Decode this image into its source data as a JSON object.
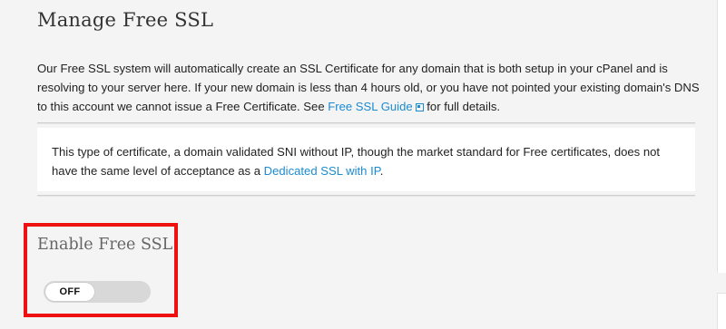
{
  "page": {
    "title": "Manage Free SSL"
  },
  "intro": {
    "text_before_link": "Our Free SSL system will automatically create an SSL Certificate for any domain that is both setup in your cPanel and is resolving to your server here. If your new domain is less than 4 hours old, or you have not pointed your existing domain's DNS to this account we cannot issue a Free Certificate. See ",
    "guide_link_label": "Free SSL Guide",
    "guide_link_icon": "external-link-icon",
    "text_after_link": " for full details."
  },
  "notice": {
    "text_before_link": "This type of certificate, a domain validated SNI without IP, though the market standard for Free certificates, does not have the same level of acceptance as a ",
    "dedicated_link_label": "Dedicated SSL with IP",
    "text_after_link": "."
  },
  "enable_section": {
    "title": "Enable Free SSL",
    "toggle_state_label": "OFF",
    "toggle_on": false
  },
  "colors": {
    "link": "#1b8bd0",
    "highlight_border": "#ee1111",
    "background": "#f4f4f4"
  }
}
